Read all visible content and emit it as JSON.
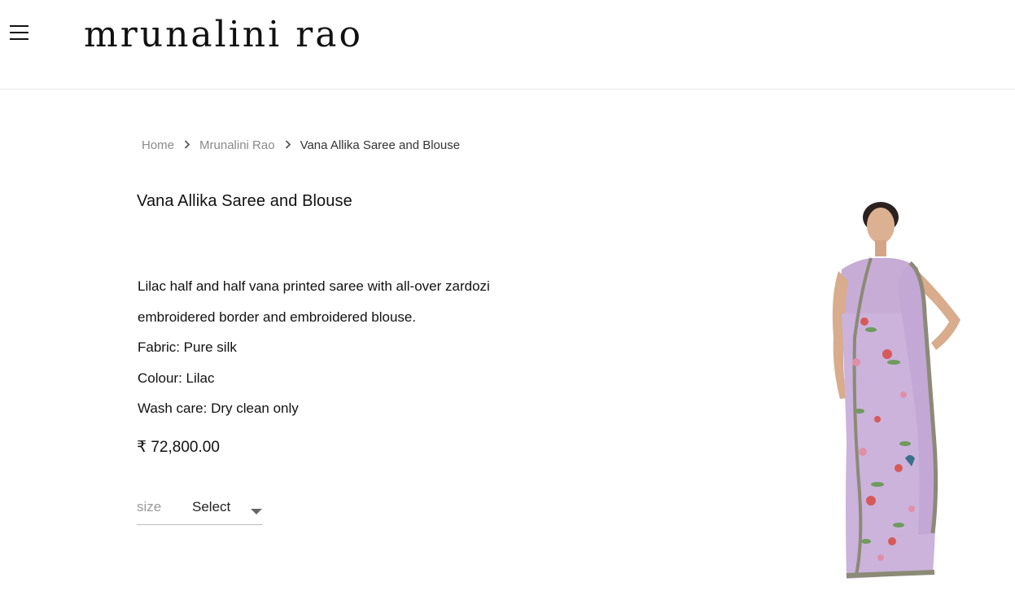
{
  "header": {
    "menu_icon": "hamburger-menu-icon",
    "logo_text": "mrunalini rao"
  },
  "breadcrumb": {
    "items": [
      "Home",
      "Mrunalini Rao",
      "Vana Allika Saree and Blouse"
    ],
    "separator_icon": "chevron-right-icon"
  },
  "product": {
    "title": "Vana Allika Saree and Blouse",
    "description_lines": [
      "Lilac half and half vana printed saree with all-over zardozi",
      "embroidered border and embroidered blouse.",
      "Fabric: Pure silk",
      "Colour: Lilac",
      "Wash care: Dry clean only"
    ],
    "price": "₹ 72,800.00",
    "size": {
      "label": "size",
      "selected": "Select"
    },
    "image": {
      "subject": "woman-in-lilac-saree",
      "color": "#c9b2d9"
    }
  },
  "colors": {
    "text": "#111111",
    "muted": "#8a8a8a",
    "saree_lilac": "#c9b2d9",
    "border_embroidery": "#8a8a7a"
  }
}
